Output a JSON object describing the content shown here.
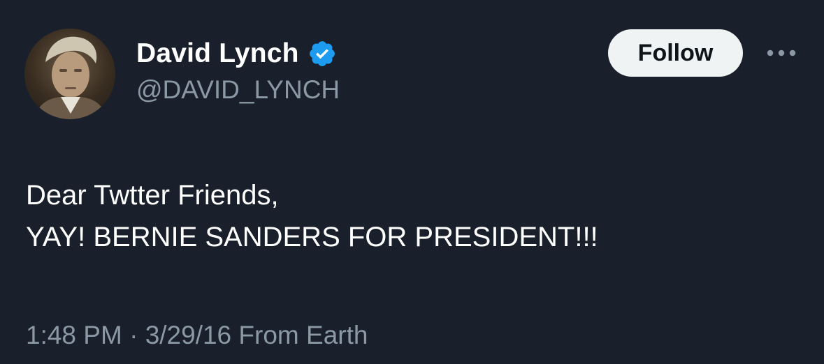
{
  "author": {
    "display_name": "David Lynch",
    "handle": "@DAVID_LYNCH",
    "verified": true,
    "verified_icon": "verified-badge-icon",
    "verified_color": "#1d9bf0"
  },
  "actions": {
    "follow_label": "Follow",
    "more_icon": "more-horizontal-icon"
  },
  "tweet": {
    "lines": [
      "Dear Twtter Friends,",
      "YAY! BERNIE SANDERS FOR PRESIDENT!!!"
    ],
    "time": "1:48 PM",
    "separator": "·",
    "date": "3/29/16",
    "source": "From Earth"
  },
  "theme": {
    "background": "#1a202b",
    "text": "#ffffff",
    "secondary_text": "#8b98a5",
    "button_bg": "#eff3f4"
  }
}
